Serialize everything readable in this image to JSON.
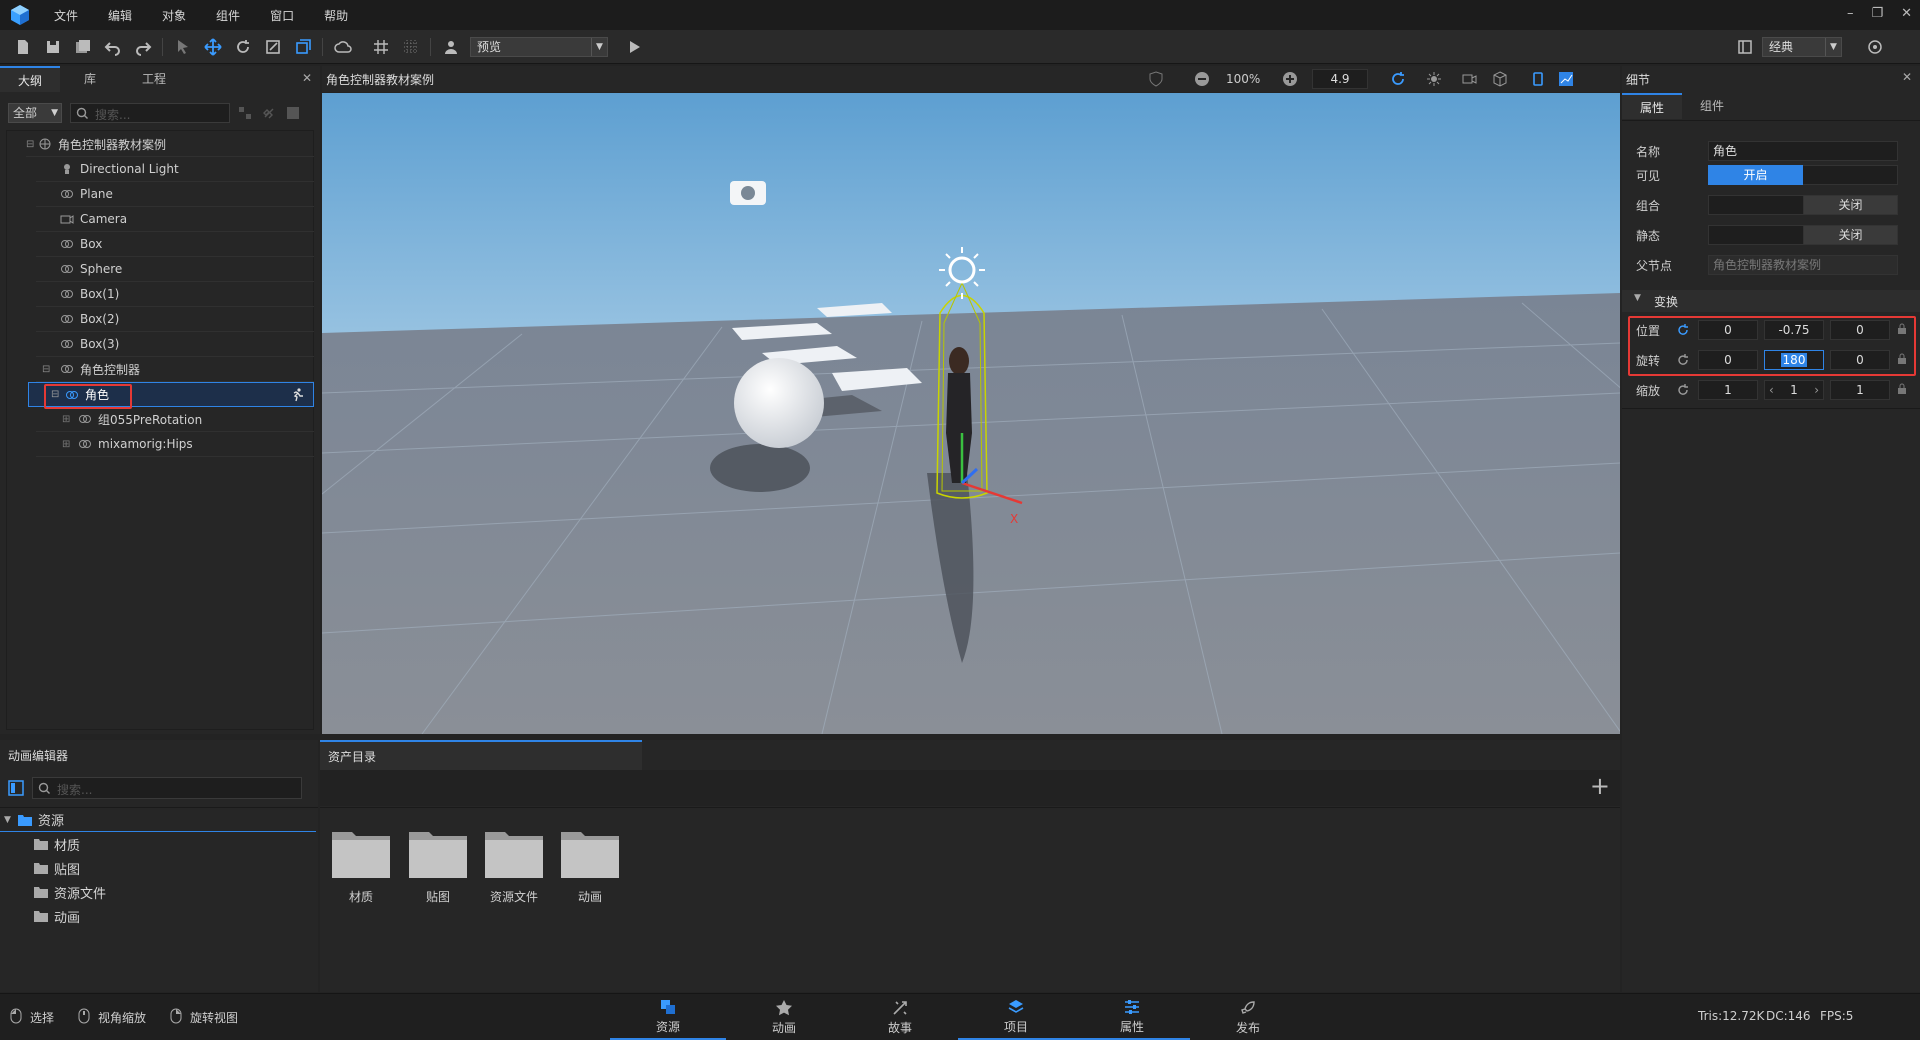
{
  "menubar": {
    "items": [
      "文件",
      "编辑",
      "对象",
      "组件",
      "窗口",
      "帮助"
    ]
  },
  "toolbar": {
    "preview_combo": "预览",
    "layout_combo": "经典"
  },
  "left_panel": {
    "tabs": [
      "大纲",
      "库",
      "工程"
    ],
    "filter": "全部",
    "search_placeholder": "搜索...",
    "tree": [
      {
        "label": "角色控制器教材案例",
        "icon": "scene-icon"
      },
      {
        "label": "Directional Light",
        "icon": "light-icon"
      },
      {
        "label": "Plane",
        "icon": "object-icon"
      },
      {
        "label": "Camera",
        "icon": "camera-icon"
      },
      {
        "label": "Box",
        "icon": "object-icon"
      },
      {
        "label": "Sphere",
        "icon": "object-icon"
      },
      {
        "label": "Box(1)",
        "icon": "object-icon"
      },
      {
        "label": "Box(2)",
        "icon": "object-icon"
      },
      {
        "label": "Box(3)",
        "icon": "object-icon"
      },
      {
        "label": "角色控制器",
        "icon": "object-icon"
      },
      {
        "label": "角色",
        "icon": "object-icon"
      },
      {
        "label": "组055PreRotation",
        "icon": "object-icon"
      },
      {
        "label": "mixamorig:Hips",
        "icon": "object-icon"
      }
    ]
  },
  "viewport": {
    "title": "角色控制器教材案例",
    "zoom": "100%",
    "speed": "4.9",
    "axis_label": "X"
  },
  "details": {
    "title": "细节",
    "tabs": [
      "属性",
      "组件"
    ],
    "name_label": "名称",
    "name_value": "角色",
    "visible_label": "可见",
    "visible_value": "开启",
    "group_label": "组合",
    "group_value": "关闭",
    "static_label": "静态",
    "static_value": "关闭",
    "parent_label": "父节点",
    "parent_value": "角色控制器教材案例",
    "transform_header": "变换",
    "position_label": "位置",
    "position": [
      "0",
      "-0.75",
      "0"
    ],
    "rotation_label": "旋转",
    "rotation": [
      "0",
      "180",
      "0"
    ],
    "scale_label": "缩放",
    "scale": [
      "1",
      "1",
      "1"
    ]
  },
  "anim_editor": {
    "title": "动画编辑器",
    "search_placeholder": "搜索...",
    "root": "资源",
    "children": [
      "材质",
      "贴图",
      "资源文件",
      "动画"
    ]
  },
  "asset_dir": {
    "tab": "资产目录",
    "folders": [
      "材质",
      "贴图",
      "资源文件",
      "动画"
    ]
  },
  "bottom": {
    "hints": [
      "选择",
      "视角缩放",
      "旋转视图"
    ],
    "nav": [
      "资源",
      "动画",
      "故事",
      "项目",
      "属性",
      "发布"
    ],
    "stats": {
      "tris": "Tris:12.72K",
      "dc": "DC:146",
      "fps": "FPS:5"
    }
  },
  "colors": {
    "accent": "#2f84e6",
    "highlight": "#e53935"
  }
}
